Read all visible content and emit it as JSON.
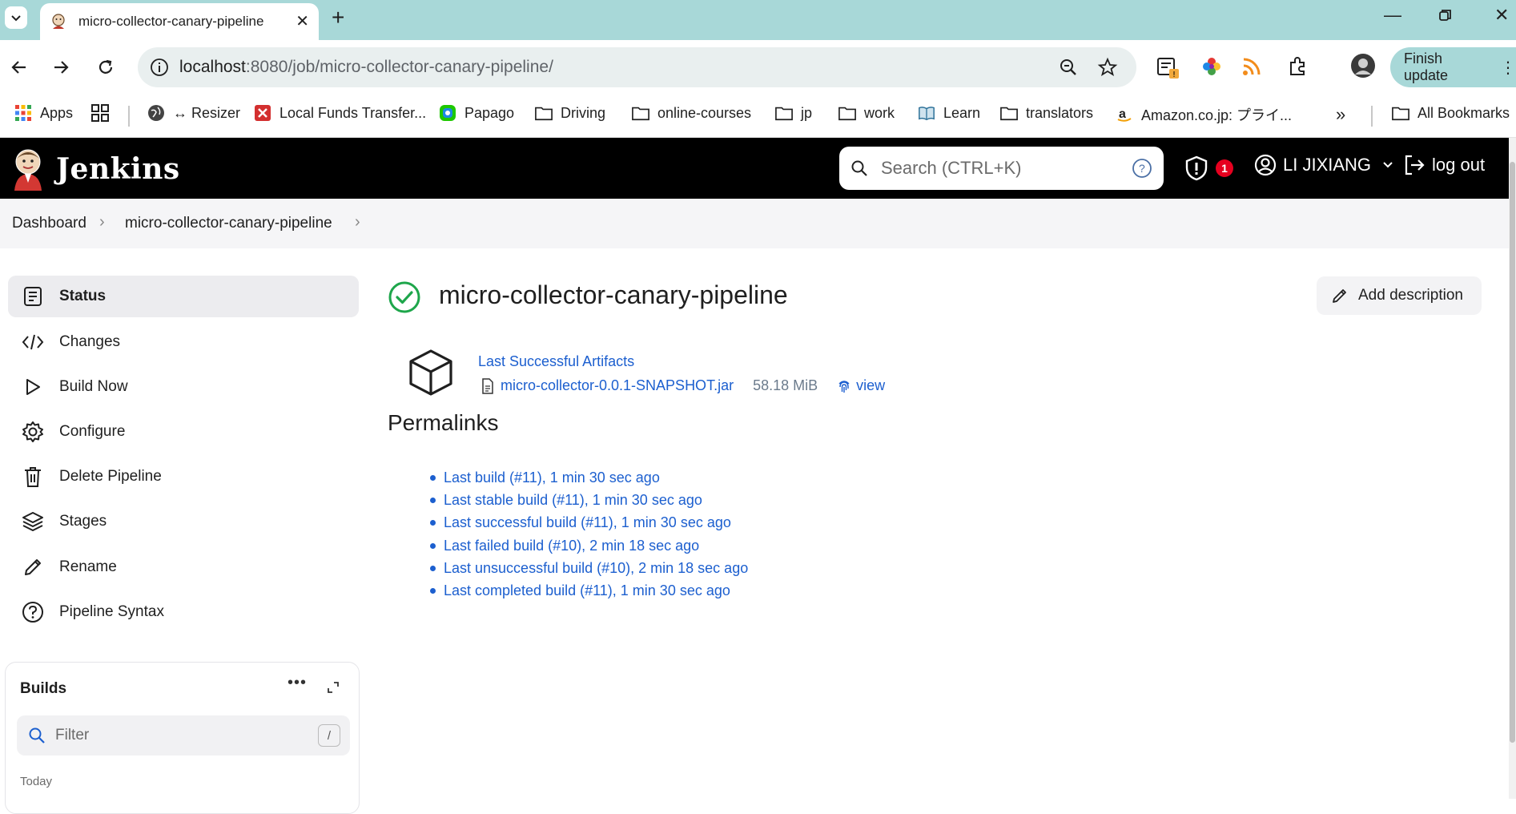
{
  "browser": {
    "tab_title": "micro-collector-canary-pipeline",
    "url_host": "localhost",
    "url_rest": ":8080/job/micro-collector-canary-pipeline/",
    "finish_update_label": "Finish update",
    "bookmarks": [
      {
        "label": "Apps",
        "icon": "apps-grid-icon"
      },
      {
        "label": "",
        "icon": "tab-groups-icon"
      },
      {
        "label": "↔ Resizer",
        "icon": "globe-icon"
      },
      {
        "label": "Local Funds Transfer...",
        "icon": "red-x-icon"
      },
      {
        "label": "Papago",
        "icon": "papago-icon"
      },
      {
        "label": "Driving",
        "icon": "folder-icon"
      },
      {
        "label": "online-courses",
        "icon": "folder-icon"
      },
      {
        "label": "jp",
        "icon": "folder-icon"
      },
      {
        "label": "work",
        "icon": "folder-icon"
      },
      {
        "label": "Learn",
        "icon": "book-icon"
      },
      {
        "label": "translators",
        "icon": "folder-icon"
      },
      {
        "label": "Amazon.co.jp: プライ...",
        "icon": "amazon-icon"
      }
    ],
    "all_bookmarks_label": "All Bookmarks"
  },
  "jenkins": {
    "brand": "Jenkins",
    "search_placeholder": "Search (CTRL+K)",
    "security_count": "1",
    "user_name": "LI JIXIANG",
    "logout_label": "log out"
  },
  "breadcrumb": {
    "items": [
      "Dashboard",
      "micro-collector-canary-pipeline"
    ]
  },
  "sidebar": {
    "items": [
      {
        "label": "Status",
        "icon": "document-icon",
        "active": true
      },
      {
        "label": "Changes",
        "icon": "code-icon"
      },
      {
        "label": "Build Now",
        "icon": "play-icon"
      },
      {
        "label": "Configure",
        "icon": "gear-icon"
      },
      {
        "label": "Delete Pipeline",
        "icon": "trash-icon"
      },
      {
        "label": "Stages",
        "icon": "layers-icon"
      },
      {
        "label": "Rename",
        "icon": "pencil-icon"
      },
      {
        "label": "Pipeline Syntax",
        "icon": "help-icon"
      }
    ],
    "builds": {
      "title": "Builds",
      "more": "•••",
      "filter_placeholder": "Filter",
      "filter_shortcut": "/",
      "group_label": "Today"
    }
  },
  "main": {
    "title": "micro-collector-canary-pipeline",
    "add_description_label": "Add description",
    "artifacts": {
      "title": "Last Successful Artifacts",
      "file_name": "micro-collector-0.0.1-SNAPSHOT.jar",
      "file_size": "58.18 MiB",
      "view_label": "view"
    },
    "permalinks_heading": "Permalinks",
    "permalinks": [
      "Last build (#11), 1 min 30 sec ago",
      "Last stable build (#11), 1 min 30 sec ago",
      "Last successful build (#11), 1 min 30 sec ago",
      "Last failed build (#10), 2 min 18 sec ago",
      "Last unsuccessful build (#10), 2 min 18 sec ago",
      "Last completed build (#11), 1 min 30 sec ago"
    ]
  },
  "colors": {
    "link": "#1c5fcf",
    "success": "#1ea64b",
    "header_bg": "#000000",
    "tabstrip_bg": "#a8d8d8",
    "badge": "#e6001f"
  }
}
